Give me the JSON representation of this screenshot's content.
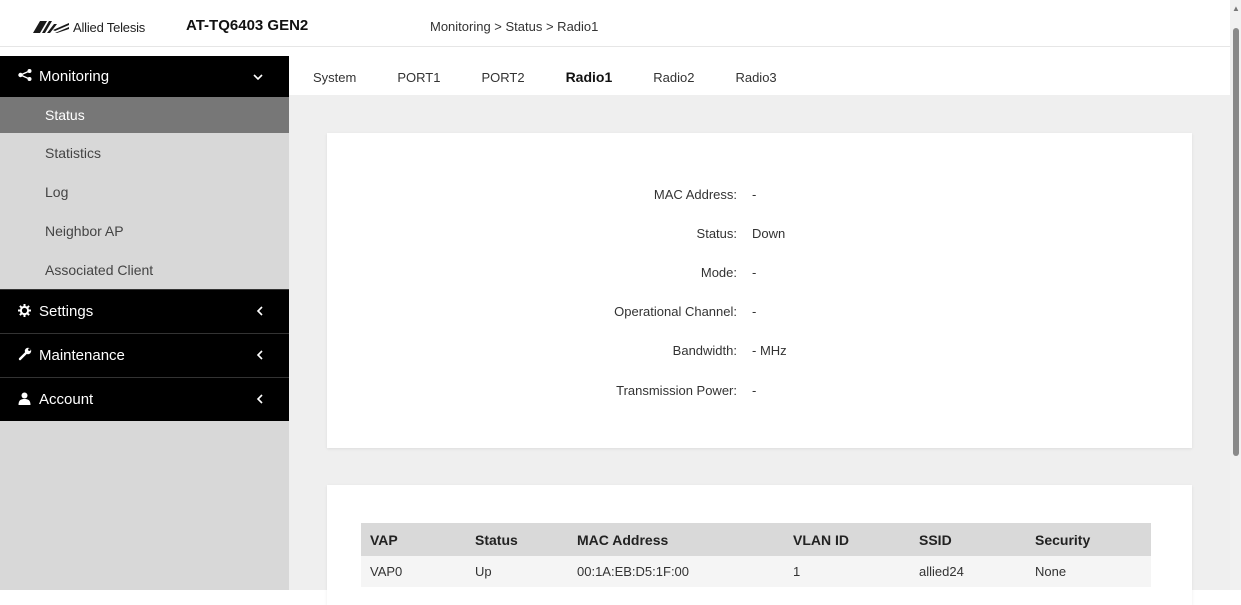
{
  "header": {
    "logo_text": "Allied Telesis",
    "model": "AT-TQ6403 GEN2",
    "breadcrumb": "Monitoring > Status > Radio1"
  },
  "sidebar": {
    "monitoring": {
      "label": "Monitoring",
      "icon": "share-icon",
      "expanded": true
    },
    "monitoring_items": [
      {
        "label": "Status",
        "active": true
      },
      {
        "label": "Statistics",
        "active": false
      },
      {
        "label": "Log",
        "active": false
      },
      {
        "label": "Neighbor AP",
        "active": false
      },
      {
        "label": "Associated Client",
        "active": false
      }
    ],
    "settings": {
      "label": "Settings",
      "icon": "gear-icon"
    },
    "maintenance": {
      "label": "Maintenance",
      "icon": "wrench-icon"
    },
    "account": {
      "label": "Account",
      "icon": "user-icon"
    }
  },
  "tabs": [
    {
      "label": "System",
      "active": false
    },
    {
      "label": "PORT1",
      "active": false
    },
    {
      "label": "PORT2",
      "active": false
    },
    {
      "label": "Radio1",
      "active": true
    },
    {
      "label": "Radio2",
      "active": false
    },
    {
      "label": "Radio3",
      "active": false
    }
  ],
  "radio_info": [
    {
      "label": "MAC Address:",
      "value": "-"
    },
    {
      "label": "Status:",
      "value": "Down"
    },
    {
      "label": "Mode:",
      "value": "-"
    },
    {
      "label": "Operational Channel:",
      "value": "-"
    },
    {
      "label": "Bandwidth:",
      "value": "- MHz"
    },
    {
      "label": "Transmission Power:",
      "value": "-"
    }
  ],
  "vap_table": {
    "headers": [
      "VAP",
      "Status",
      "MAC Address",
      "VLAN ID",
      "SSID",
      "Security"
    ],
    "rows": [
      [
        "VAP0",
        "Up",
        "00:1A:EB:D5:1F:00",
        "1",
        "allied24",
        "None"
      ]
    ]
  },
  "colors": {
    "sidebar_section_bg": "#000000",
    "sidebar_active_bg": "#777777",
    "sidebar_bg": "#d8d8d8",
    "main_bg": "#efefef",
    "table_header_bg": "#d9d9d9"
  }
}
